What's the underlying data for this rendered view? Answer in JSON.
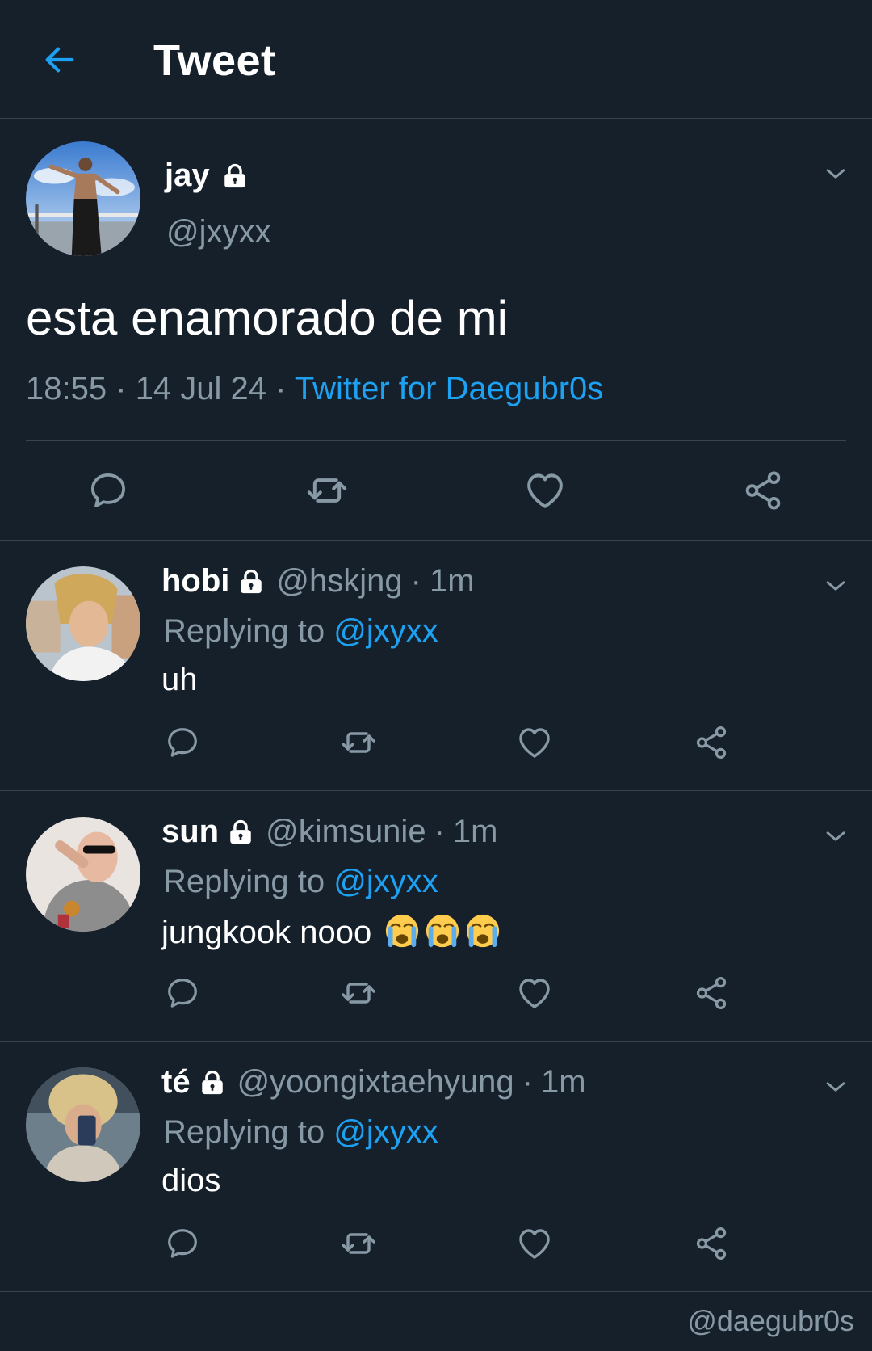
{
  "header": {
    "title": "Tweet",
    "back_icon": "back-arrow-icon",
    "accent": "#1da1f2"
  },
  "main_tweet": {
    "name": "jay",
    "handle": "@jxyxx",
    "text": "esta enamorado de mi",
    "time": "18:55",
    "date": "14 Jul 24",
    "source": "Twitter for Daegubr0s",
    "sep": "·"
  },
  "replies": [
    {
      "name": "hobi",
      "handle": "@hskjng",
      "time": "1m",
      "replying_label": "Replying to",
      "replying_to": "@jxyxx",
      "text": "uh"
    },
    {
      "name": "sun",
      "handle": "@kimsunie",
      "time": "1m",
      "replying_label": "Replying to",
      "replying_to": "@jxyxx",
      "text": "jungkook nooo",
      "emoji": "😭😭😭"
    },
    {
      "name": "té",
      "handle": "@yoongixtaehyung",
      "time": "1m",
      "replying_label": "Replying to",
      "replying_to": "@jxyxx",
      "text": "dios"
    }
  ],
  "watermark": "@daegubr0s",
  "colors": {
    "background": "#15202b",
    "border": "#38444d",
    "secondary_text": "#8899a6",
    "link": "#1da1f2"
  }
}
